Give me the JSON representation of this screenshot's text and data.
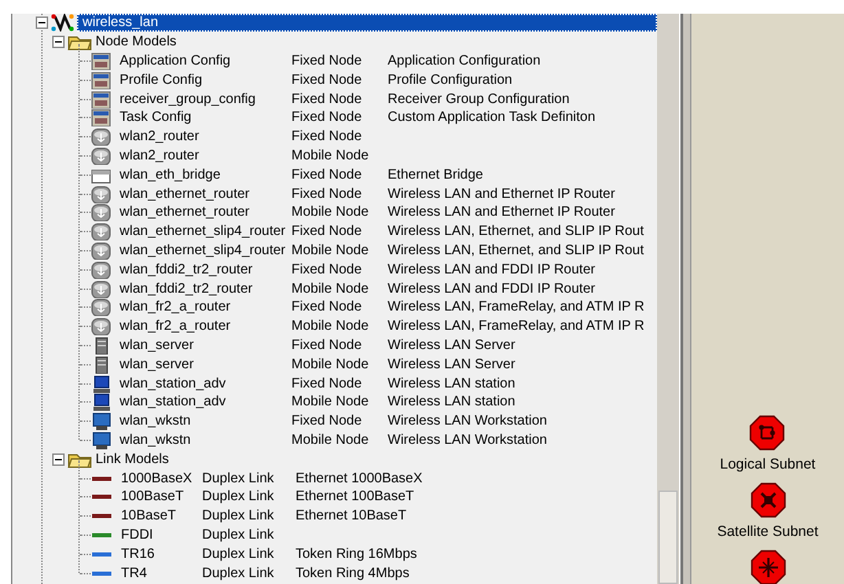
{
  "tree": {
    "root": {
      "label": "wireless_lan",
      "selected": true,
      "expanded": true
    },
    "groups": [
      {
        "label": "Node Models",
        "expanded": true,
        "kind": "node",
        "items": [
          {
            "kind": "config",
            "name": "Application Config",
            "type": "Fixed Node",
            "description": "Application Configuration"
          },
          {
            "kind": "config",
            "name": "Profile Config",
            "type": "Fixed Node",
            "description": "Profile Configuration"
          },
          {
            "kind": "config",
            "name": "receiver_group_config",
            "type": "Fixed Node",
            "description": "Receiver Group Configuration"
          },
          {
            "kind": "config",
            "name": "Task Config",
            "type": "Fixed Node",
            "description": "Custom Application Task Definiton"
          },
          {
            "kind": "router",
            "name": "wlan2_router",
            "type": "Fixed Node"
          },
          {
            "kind": "router",
            "name": "wlan2_router",
            "type": "Mobile Node"
          },
          {
            "kind": "bridge",
            "name": "wlan_eth_bridge",
            "type": "Fixed Node",
            "description": "Ethernet Bridge"
          },
          {
            "kind": "router",
            "name": "wlan_ethernet_router",
            "type": "Fixed Node",
            "description": "Wireless LAN and Ethernet IP Router"
          },
          {
            "kind": "router",
            "name": "wlan_ethernet_router",
            "type": "Mobile Node",
            "description": "Wireless LAN and Ethernet IP Router"
          },
          {
            "kind": "router",
            "name": "wlan_ethernet_slip4_router",
            "type": "Fixed Node",
            "description": "Wireless LAN, Ethernet, and SLIP IP Rout"
          },
          {
            "kind": "router",
            "name": "wlan_ethernet_slip4_router",
            "type": "Mobile Node",
            "description": "Wireless LAN, Ethernet, and SLIP IP Rout"
          },
          {
            "kind": "router",
            "name": "wlan_fddi2_tr2_router",
            "type": "Fixed Node",
            "description": "Wireless LAN and FDDI IP Router"
          },
          {
            "kind": "router",
            "name": "wlan_fddi2_tr2_router",
            "type": "Mobile Node",
            "description": "Wireless LAN and FDDI IP Router"
          },
          {
            "kind": "router",
            "name": "wlan_fr2_a_router",
            "type": "Fixed Node",
            "description": "Wireless LAN, FrameRelay, and ATM IP R"
          },
          {
            "kind": "router",
            "name": "wlan_fr2_a_router",
            "type": "Mobile Node",
            "description": "Wireless LAN, FrameRelay, and ATM IP R"
          },
          {
            "kind": "server",
            "name": "wlan_server",
            "type": "Fixed Node",
            "description": "Wireless LAN Server"
          },
          {
            "kind": "server",
            "name": "wlan_server",
            "type": "Mobile Node",
            "description": "Wireless LAN Server"
          },
          {
            "kind": "station",
            "name": "wlan_station_adv",
            "type": "Fixed Node",
            "description": "Wireless LAN station"
          },
          {
            "kind": "station",
            "name": "wlan_station_adv",
            "type": "Mobile Node",
            "description": "Wireless LAN station"
          },
          {
            "kind": "workstation",
            "name": "wlan_wkstn",
            "type": "Fixed Node",
            "description": "Wireless LAN Workstation"
          },
          {
            "kind": "workstation",
            "name": "wlan_wkstn",
            "type": "Mobile Node",
            "description": "Wireless LAN Workstation"
          }
        ]
      },
      {
        "label": "Link Models",
        "expanded": true,
        "kind": "link",
        "items": [
          {
            "kind": "link",
            "color": "#7a1a1a",
            "name": "1000BaseX",
            "type": "Duplex Link",
            "description": "Ethernet 1000BaseX"
          },
          {
            "kind": "link",
            "color": "#7a1a1a",
            "name": "100BaseT",
            "type": "Duplex Link",
            "description": "Ethernet 100BaseT"
          },
          {
            "kind": "link",
            "color": "#7a1a1a",
            "name": "10BaseT",
            "type": "Duplex Link",
            "description": "Ethernet 10BaseT"
          },
          {
            "kind": "link",
            "color": "#2a8a2a",
            "name": "FDDI",
            "type": "Duplex Link"
          },
          {
            "kind": "link",
            "color": "#2a6fd6",
            "name": "TR16",
            "type": "Duplex Link",
            "description": "Token Ring 16Mbps"
          },
          {
            "kind": "link",
            "color": "#2a6fd6",
            "name": "TR4",
            "type": "Duplex Link",
            "description": "Token Ring 4Mbps"
          }
        ]
      }
    ]
  },
  "palette": [
    {
      "kind": "logical",
      "label": "Logical Subnet"
    },
    {
      "kind": "satellite",
      "label": "Satellite Subnet"
    },
    {
      "kind": "mobile"
    }
  ]
}
